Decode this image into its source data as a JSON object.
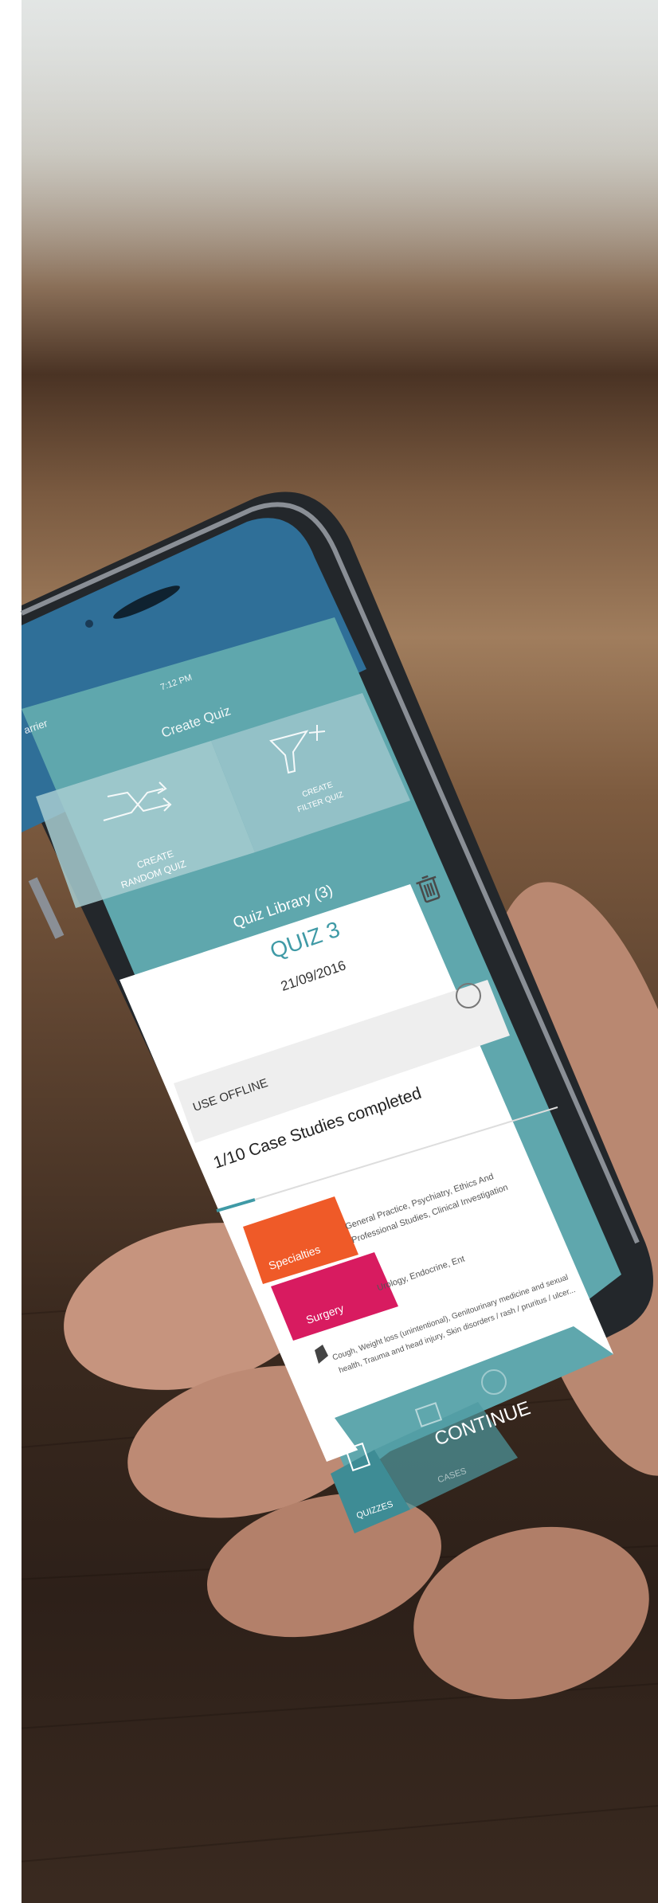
{
  "status_bar": {
    "carrier": "arrier",
    "time": "7:12 PM"
  },
  "header": {
    "title": "Create Quiz"
  },
  "create_options": {
    "random": {
      "line1": "CREATE",
      "line2": "RANDOM QUIZ",
      "icon": "shuffle-icon"
    },
    "filter": {
      "line1": "CREATE",
      "line2": "FILTER QUIZ",
      "icon": "filter-plus-icon"
    }
  },
  "library": {
    "title": "Quiz Library (3)"
  },
  "quiz": {
    "name": "QUIZ 3",
    "date": "21/09/2016",
    "offline_label": "USE OFFLINE",
    "progress_text": "1/10 Case Studies completed",
    "progress": 0.1,
    "tags": [
      {
        "label": "Specialties",
        "color": "#ef5a28",
        "description_line1": "General Practice, Psychiatry, Ethics And",
        "description_line2": "Professional Studies, Clinical Investigation"
      },
      {
        "label": "Surgery",
        "color": "#d81b60",
        "description_line1": "Urology, Endocrine, Ent",
        "description_line2": ""
      }
    ],
    "keywords_line1": "Cough, Weight loss (unintentional), Genitourinary medicine and sexual",
    "keywords_line2": "health, Trauma and head injury, Skin disorders / rash / pruritus / ulcer...",
    "continue_label": "CONTINUE"
  },
  "tab_bar": {
    "tabs": [
      {
        "label": "QUIZZES",
        "icon": "list-icon",
        "active": true
      },
      {
        "label": "CASES",
        "icon": "case-icon",
        "active": false
      },
      {
        "label": "",
        "icon": "globe-icon",
        "active": false
      }
    ]
  },
  "colors": {
    "teal": "#5fa7ad",
    "teal_dark": "#3e8c95",
    "accent_text": "#3f9aa6",
    "orange": "#ef5a28",
    "magenta": "#d81b60"
  }
}
